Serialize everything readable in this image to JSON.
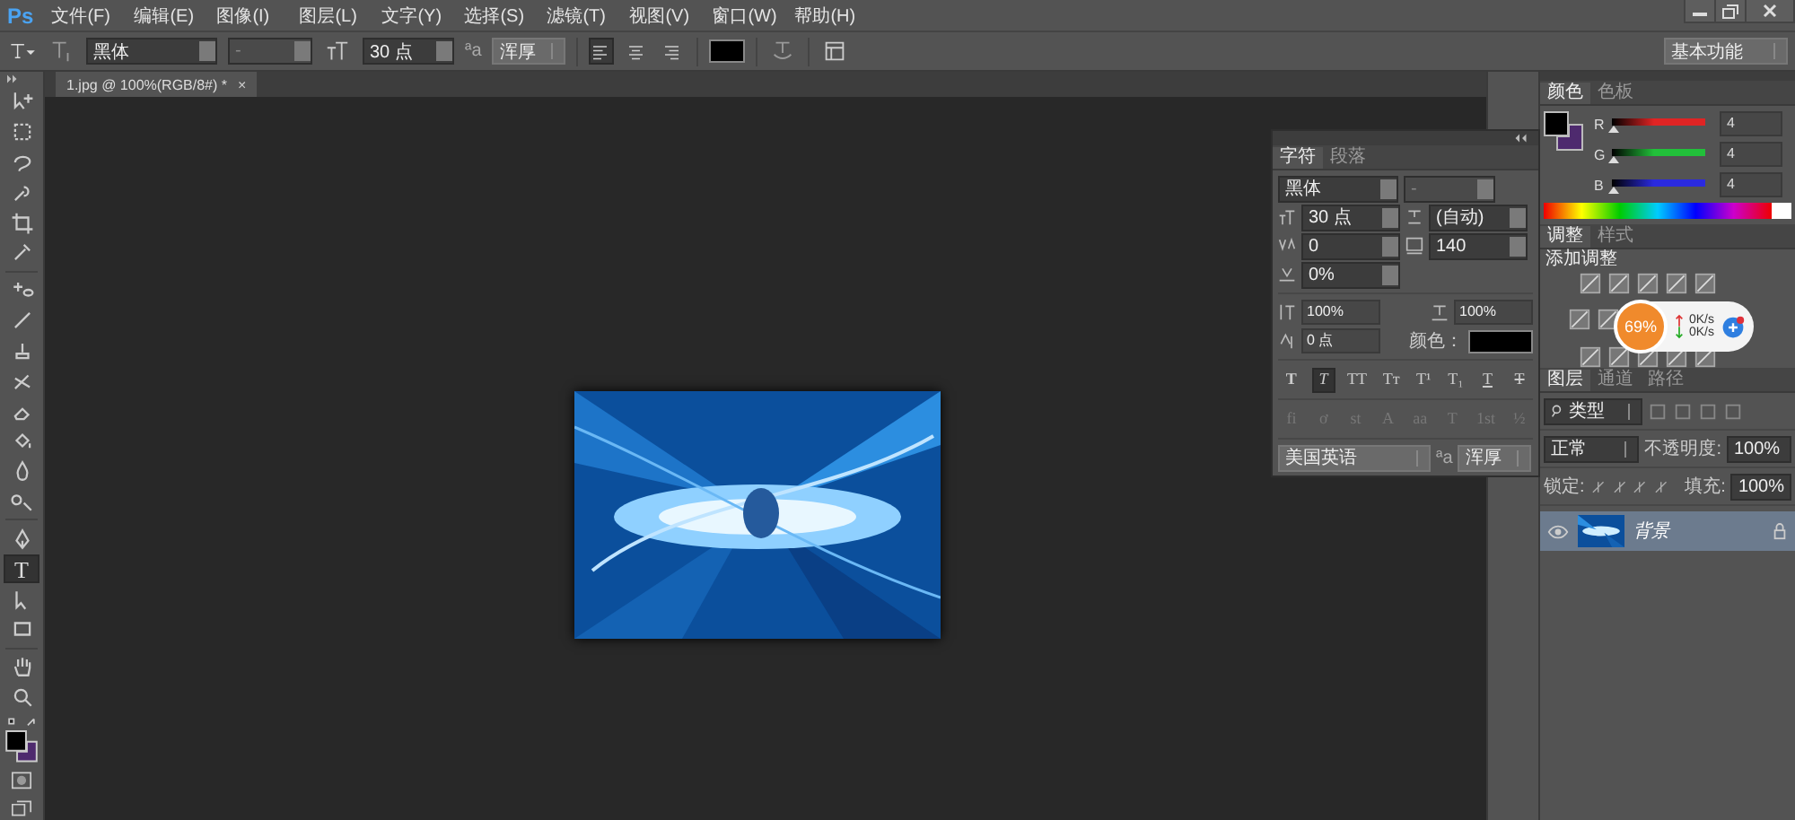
{
  "app": {
    "logo": "Ps"
  },
  "menu": [
    "文件(F)",
    "编辑(E)",
    "图像(I)",
    "图层(L)",
    "文字(Y)",
    "选择(S)",
    "滤镜(T)",
    "视图(V)",
    "窗口(W)",
    "帮助(H)"
  ],
  "options_bar": {
    "font_family": "黑体",
    "font_style": "-",
    "font_size": "30 点",
    "antialias_glyph": "ªa",
    "antialias": "浑厚",
    "align": [
      {
        "kind": "left",
        "selected": true
      },
      {
        "kind": "center",
        "selected": false
      },
      {
        "kind": "right",
        "selected": false
      }
    ],
    "text_color": {
      "color": "#000000"
    },
    "workspace": "基本功能"
  },
  "document_tab": {
    "title": "1.jpg @ 100%(RGB/8#) *",
    "close": "×"
  },
  "tools": [
    {
      "kind": "move",
      "selected": false
    },
    {
      "kind": "marquee",
      "selected": false
    },
    {
      "kind": "lasso",
      "selected": false
    },
    {
      "kind": "quick",
      "selected": false
    },
    {
      "kind": "crop",
      "selected": false
    },
    {
      "kind": "eyedropper",
      "selected": false
    },
    {
      "kind": "heal",
      "selected": false
    },
    {
      "kind": "brush",
      "selected": false
    },
    {
      "kind": "stamp",
      "selected": false
    },
    {
      "kind": "history",
      "selected": false
    },
    {
      "kind": "eraser",
      "selected": false
    },
    {
      "kind": "bucket",
      "selected": false
    },
    {
      "kind": "blur",
      "selected": false
    },
    {
      "kind": "dodge",
      "selected": false
    },
    {
      "kind": "pen",
      "selected": false
    },
    {
      "kind": "type",
      "label": "T",
      "selected": true
    },
    {
      "kind": "select",
      "selected": false
    },
    {
      "kind": "shape",
      "selected": false
    },
    {
      "kind": "hand",
      "selected": false
    },
    {
      "kind": "zoom",
      "selected": false
    }
  ],
  "swatches": [
    {
      "kind": "foreground",
      "color": "#000000"
    },
    {
      "kind": "background",
      "color": "#4e2a6e"
    }
  ],
  "character_panel": {
    "tabs": [
      {
        "label": "字符",
        "selected": true
      },
      {
        "label": "段落",
        "selected": false
      }
    ],
    "font_family": "黑体",
    "font_style": "-",
    "size": "30 点",
    "leading": "(自动)",
    "kerning": "0",
    "tracking": "140",
    "tsume": "0%",
    "vertical_scale": "100%",
    "horizontal_scale": "100%",
    "baseline_shift": "0 点",
    "color_label": "颜色：",
    "text_color": {
      "color": "#000000"
    },
    "styles": [
      {
        "kind": "bold",
        "label": "T",
        "selected": false
      },
      {
        "kind": "italic",
        "label": "T",
        "selected": true
      },
      {
        "kind": "caps",
        "label": "TT",
        "selected": false
      },
      {
        "kind": "smallcaps",
        "label": "Tт",
        "selected": false
      },
      {
        "kind": "super",
        "label": "T¹",
        "selected": false
      },
      {
        "kind": "sub",
        "label": "T₁",
        "selected": false
      },
      {
        "kind": "underline",
        "label": "T",
        "selected": false
      },
      {
        "kind": "strike",
        "label": "T",
        "selected": false
      }
    ],
    "opentype": [
      "fi",
      "ơ",
      "st",
      "A",
      "aa",
      "T",
      "1st",
      "½"
    ],
    "language": "美国英语",
    "antialias_glyph": "ªa",
    "antialias": "浑厚"
  },
  "color_panel": {
    "tabs": [
      {
        "label": "颜色",
        "selected": true
      },
      {
        "label": "色板",
        "selected": false
      }
    ],
    "channels": [
      {
        "label": "R",
        "level": 0.016,
        "value": "4",
        "color": "#e02424"
      },
      {
        "label": "G",
        "level": 0.016,
        "value": "4",
        "color": "#22c03a"
      },
      {
        "label": "B",
        "level": 0.016,
        "value": "4",
        "color": "#2a2ae0"
      }
    ]
  },
  "adjustments_panel": {
    "tabs": [
      {
        "label": "调整",
        "selected": true
      },
      {
        "label": "样式",
        "selected": false
      }
    ],
    "title": "添加调整"
  },
  "layers_panel": {
    "tabs": [
      {
        "label": "图层",
        "selected": true
      },
      {
        "label": "通道",
        "selected": false
      },
      {
        "label": "路径",
        "selected": false
      }
    ],
    "filter": "类型",
    "blend_mode": "正常",
    "opacity_label": "不透明度:",
    "opacity": "100%",
    "lock_label": "锁定:",
    "fill_label": "填充:",
    "fill": "100%",
    "layers": [
      {
        "name": "背景",
        "visible": true,
        "locked": true,
        "selected": true
      }
    ]
  },
  "speed_widget": {
    "percent": "69%",
    "upload": "0K/s",
    "download": "0K/s"
  }
}
